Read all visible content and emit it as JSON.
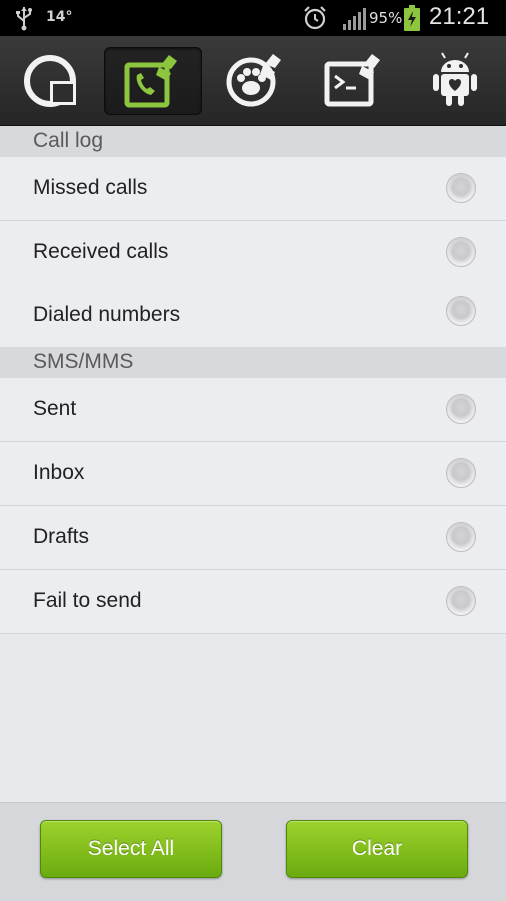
{
  "status_bar": {
    "temperature": "14°",
    "battery_percent": "95%",
    "time": "21:21",
    "icons": [
      "usb-icon",
      "alarm-icon",
      "signal-icon",
      "battery-charging-icon"
    ]
  },
  "tabs": [
    {
      "icon": "storage-cleaner-icon",
      "active": false
    },
    {
      "icon": "call-log-cleaner-icon",
      "active": true
    },
    {
      "icon": "browser-history-cleaner-icon",
      "active": false
    },
    {
      "icon": "terminal-cleaner-icon",
      "active": false
    },
    {
      "icon": "android-app-icon",
      "active": false
    }
  ],
  "sections": [
    {
      "title": "Call log",
      "items": [
        {
          "label": "Missed calls",
          "checked": false
        },
        {
          "label": "Received calls",
          "checked": false
        },
        {
          "label": "Dialed numbers",
          "checked": false
        }
      ]
    },
    {
      "title": "SMS/MMS",
      "items": [
        {
          "label": "Sent",
          "checked": false
        },
        {
          "label": "Inbox",
          "checked": false
        },
        {
          "label": "Drafts",
          "checked": false
        },
        {
          "label": "Fail to send",
          "checked": false
        }
      ]
    }
  ],
  "buttons": {
    "select_all": "Select All",
    "clear": "Clear"
  },
  "colors": {
    "accent": "#8cc63f",
    "button_green_top": "#9dd22c",
    "button_green_bottom": "#6bab10"
  }
}
